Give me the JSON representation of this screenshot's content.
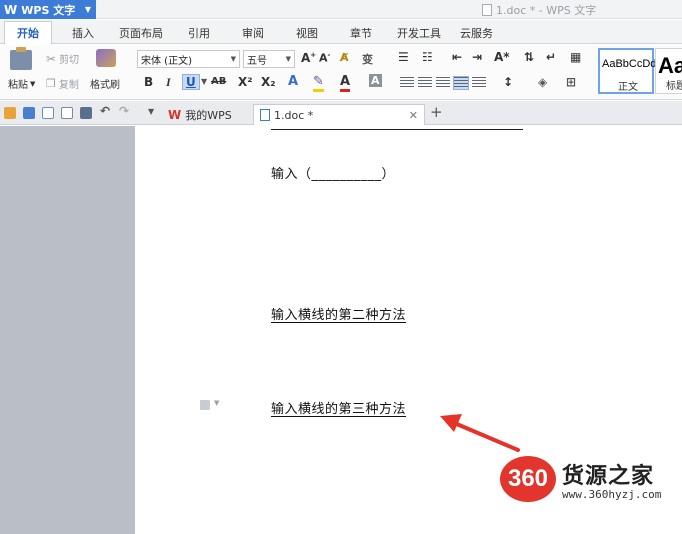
{
  "app": {
    "menu_label": "WPS 文字",
    "window_title": "1.doc * - WPS 文字"
  },
  "ribbon_tabs": [
    {
      "label": "开始",
      "active": true
    },
    {
      "label": "插入"
    },
    {
      "label": "页面布局"
    },
    {
      "label": "引用"
    },
    {
      "label": "审阅"
    },
    {
      "label": "视图"
    },
    {
      "label": "章节"
    },
    {
      "label": "开发工具"
    },
    {
      "label": "云服务"
    }
  ],
  "ribbon": {
    "paste_label": "粘贴",
    "cut_label": "剪切",
    "copy_label": "复制",
    "format_painter_label": "格式刷",
    "font_name": "宋体 (正文)",
    "font_size": "五号",
    "bold": "B",
    "italic": "I",
    "underline": "U",
    "strikethrough": "AB",
    "superscript": "X²",
    "subscript": "X₂",
    "style_normal_sample": "AaBbCcDd",
    "style_normal_name": "正文",
    "style_heading_sample": "Aa",
    "style_heading_name": "标题"
  },
  "doc_tabs": [
    {
      "label": "我的WPS"
    },
    {
      "label": "1.doc *",
      "active": true
    }
  ],
  "document": {
    "line1": "输入（__________）",
    "line2": "输入横线的第二种方法",
    "line3": "输入横线的第三种方法"
  },
  "watermark": {
    "logo": "360",
    "title": "货源之家",
    "url": "www.360hyzj.com"
  },
  "colors": {
    "accent": "#3c7bd6",
    "arrow": "#e5332a",
    "gutter": "#b9bec7"
  }
}
